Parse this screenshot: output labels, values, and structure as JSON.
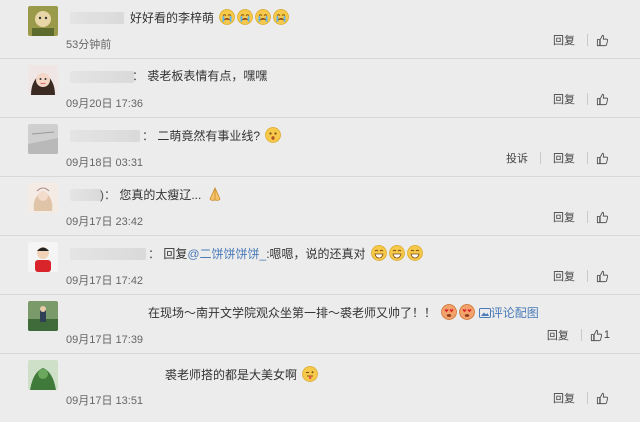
{
  "comments": [
    {
      "text": "好好看的李梓萌",
      "emojis": [
        "cry",
        "cry",
        "cry",
        "cry"
      ],
      "time": "53分钟前",
      "actions": [
        "回复"
      ],
      "likes": ""
    },
    {
      "text": "裘老板表情有点，嘿嘿",
      "emojis": [],
      "time": "09月20日 17:36",
      "actions": [
        "回复"
      ],
      "likes": ""
    },
    {
      "text": "二萌竟然有事业线?",
      "emojis": [
        "surprised"
      ],
      "time": "09月18日 03:31",
      "actions": [
        "投诉",
        "回复"
      ],
      "likes": ""
    },
    {
      "text": "您真的太瘦辽...",
      "emojis": [
        "pray"
      ],
      "time": "09月17日 23:42",
      "actions": [
        "回复"
      ],
      "likes": ""
    },
    {
      "reply_prefix": "回复",
      "mention": "@二饼饼饼饼_",
      "text": ":嗯嗯，说的还真对",
      "emojis": [
        "laugh",
        "laugh",
        "laugh"
      ],
      "time": "09月17日 17:42",
      "actions": [
        "回复"
      ],
      "likes": ""
    },
    {
      "text": "在现场～南开文学院观众坐第一排～裘老师又帅了！！",
      "emojis": [
        "heart-eyes",
        "heart-eyes"
      ],
      "link": "评论配图",
      "time": "09月17日 17:39",
      "actions": [
        "回复"
      ],
      "likes": "1"
    },
    {
      "text": "裘老师搭的都是大美女啊",
      "emojis": [
        "tongue"
      ],
      "time": "09月17日 13:51",
      "actions": [
        "回复"
      ],
      "likes": ""
    }
  ]
}
